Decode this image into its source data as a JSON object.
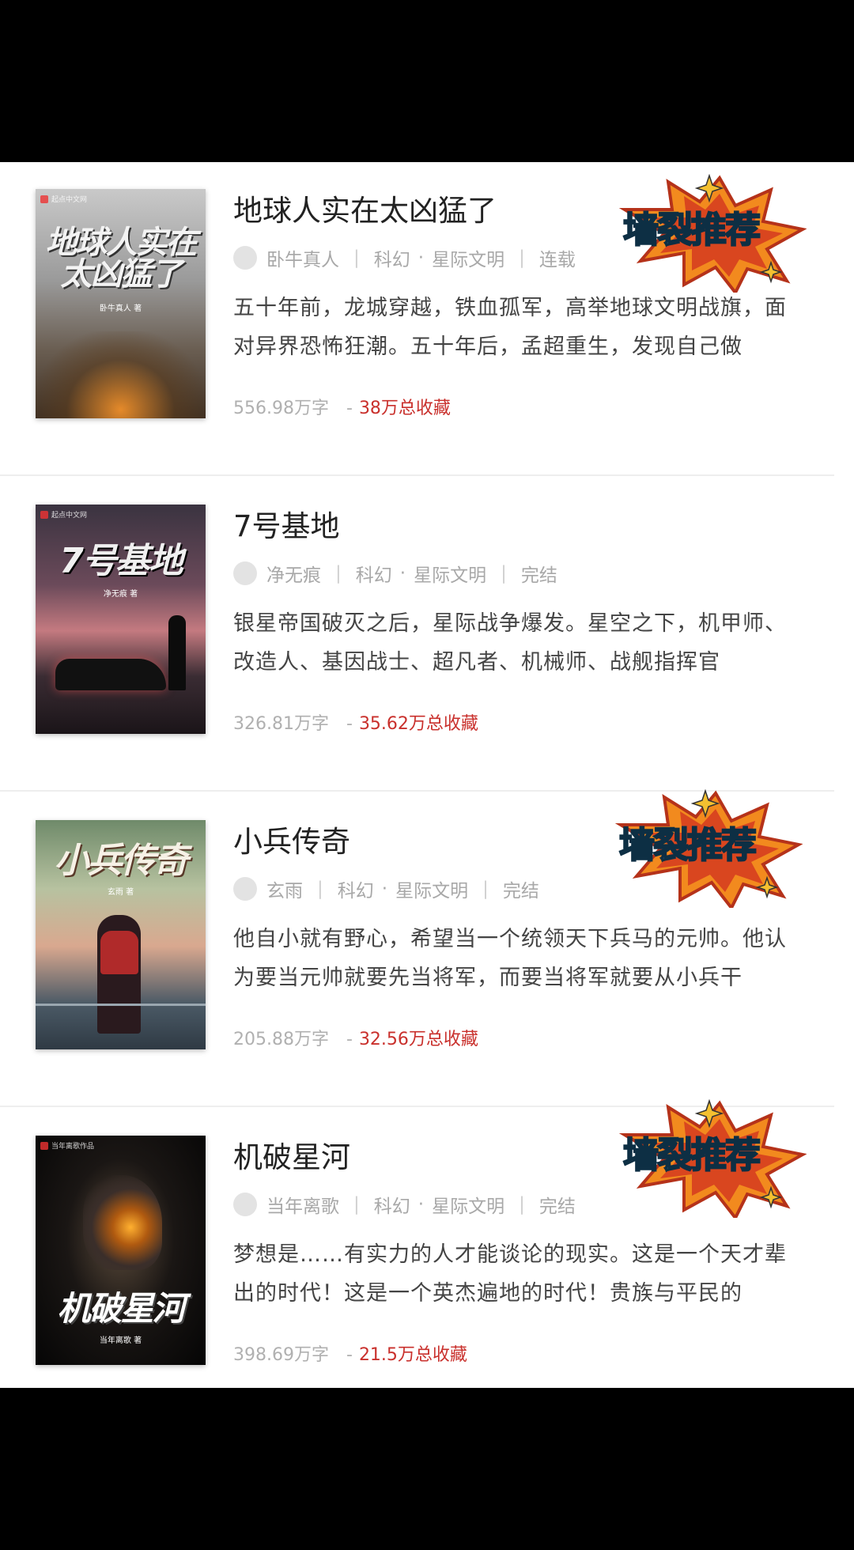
{
  "badge_text": "墙裂推荐",
  "books": [
    {
      "cover_title": "地球人实在太凶猛了",
      "cover_author": "卧牛真人 著",
      "title": "地球人实在太凶猛了",
      "author": "卧牛真人",
      "category": "科幻",
      "subcategory": "星际文明",
      "status": "连载",
      "description": "五十年前，龙城穿越，铁血孤军，高举地球文明战旗，面对异界恐怖狂潮。五十年后，孟超重生，发现自己做",
      "word_count": "556.98万字",
      "favorites": "38万总收藏",
      "recommended": true
    },
    {
      "cover_title": "7号基地",
      "cover_author": "净无痕 著",
      "title": "7号基地",
      "author": "净无痕",
      "category": "科幻",
      "subcategory": "星际文明",
      "status": "完结",
      "description": "银星帝国破灭之后，星际战争爆发。星空之下，机甲师、改造人、基因战士、超凡者、机械师、战舰指挥官",
      "word_count": "326.81万字",
      "favorites": "35.62万总收藏",
      "recommended": false
    },
    {
      "cover_title": "小兵传奇",
      "cover_author": "玄雨 著",
      "title": "小兵传奇",
      "author": "玄雨",
      "category": "科幻",
      "subcategory": "星际文明",
      "status": "完结",
      "description": "他自小就有野心，希望当一个统领天下兵马的元帅。他认为要当元帅就要先当将军，而要当将军就要从小兵干",
      "word_count": "205.88万字",
      "favorites": "32.56万总收藏",
      "recommended": true
    },
    {
      "cover_title": "机破星河",
      "cover_author": "当年离歌 著",
      "title": "机破星河",
      "author": "当年离歌",
      "category": "科幻",
      "subcategory": "星际文明",
      "status": "完结",
      "description": "梦想是……有实力的人才能谈论的现实。这是一个天才辈出的时代！这是一个英杰遍地的时代！贵族与平民的",
      "word_count": "398.69万字",
      "favorites": "21.5万总收藏",
      "recommended": true
    }
  ]
}
